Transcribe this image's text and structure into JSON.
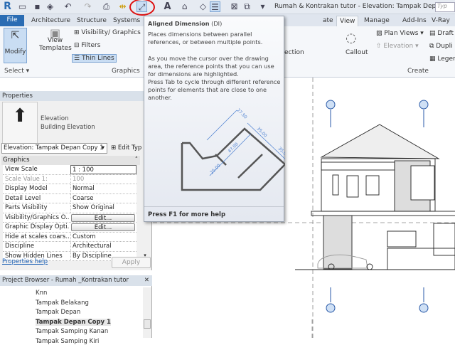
{
  "qat": {
    "logo": "R",
    "title": "Rumah & Kontrakan tutor - Elevation: Tampak Depan...",
    "search_placeholder": "Typ",
    "icons": [
      "open-icon",
      "save-icon",
      "sync-icon",
      "undo-icon",
      "redo-icon",
      "print-icon",
      "measure-icon",
      "aligned-dimension-icon",
      "tag-icon",
      "text-icon",
      "3d-view-icon",
      "section-icon",
      "thin-lines-icon",
      "close-hidden-icon",
      "switch-windows-icon",
      "customize-icon"
    ]
  },
  "tabs": {
    "file": "File",
    "items": [
      "Architecture",
      "Structure",
      "Systems",
      "ate",
      "View",
      "Manage",
      "Add-Ins",
      "V-Ray"
    ],
    "active": "View"
  },
  "ribbon": {
    "modify": "Modify",
    "select": "Select",
    "view_templates_1": "View",
    "view_templates_2": "Templates",
    "visibility": "Visibility/ Graphics",
    "filters": "Filters",
    "thin_lines": "Thin Lines",
    "graphics": "Graphics",
    "section": "ection",
    "callout": "Callout",
    "plan_views": "Plan Views",
    "elevation": "Elevation",
    "drafting": "Draft",
    "duplicate": "Dupli",
    "legends": "Legen",
    "create": "Create"
  },
  "tooltip": {
    "title": "Aligned Dimension",
    "shortcut": "(DI)",
    "p1": "Places dimensions between parallel references, or between multiple points.",
    "p2": "As you move the cursor over the drawing area, the reference points that you can use for dimensions are highlighted.",
    "p3": "Press Tab to cycle through different reference points for elements that are close to one another.",
    "footer": "Press F1 for more help",
    "dims": [
      "27.50",
      "35.00",
      "35.00",
      "47.00",
      "25.00"
    ]
  },
  "properties": {
    "header": "Properties",
    "type1": "Elevation",
    "type2": "Building Elevation",
    "selector": "Elevation: Tampak Depan Copy 1",
    "edit_type": "Edit Typ",
    "group": "Graphics",
    "rows": [
      {
        "k": "View Scale",
        "v": "1 : 100"
      },
      {
        "k": "Scale Value    1:",
        "v": "100"
      },
      {
        "k": "Display Model",
        "v": "Normal"
      },
      {
        "k": "Detail Level",
        "v": "Coarse"
      },
      {
        "k": "Parts Visibility",
        "v": "Show Original"
      },
      {
        "k": "Visibility/Graphics O...",
        "v": "Edit..."
      },
      {
        "k": "Graphic Display Opti...",
        "v": "Edit..."
      },
      {
        "k": "Hide at scales coars...",
        "v": "Custom"
      },
      {
        "k": "Discipline",
        "v": "Architectural"
      },
      {
        "k": "Show Hidden Lines",
        "v": "By Discipline"
      }
    ],
    "help": "Properties help",
    "apply": "Apply"
  },
  "browser": {
    "header": "Project Browser - Rumah _Kontrakan tutor",
    "items": [
      "Knn",
      "Tampak Belakang",
      "Tampak Depan",
      "Tampak Depan Copy 1",
      "Tampak Samping Kanan",
      "Tampak Samping Kiri"
    ],
    "selected": "Tampak Depan Copy 1"
  }
}
